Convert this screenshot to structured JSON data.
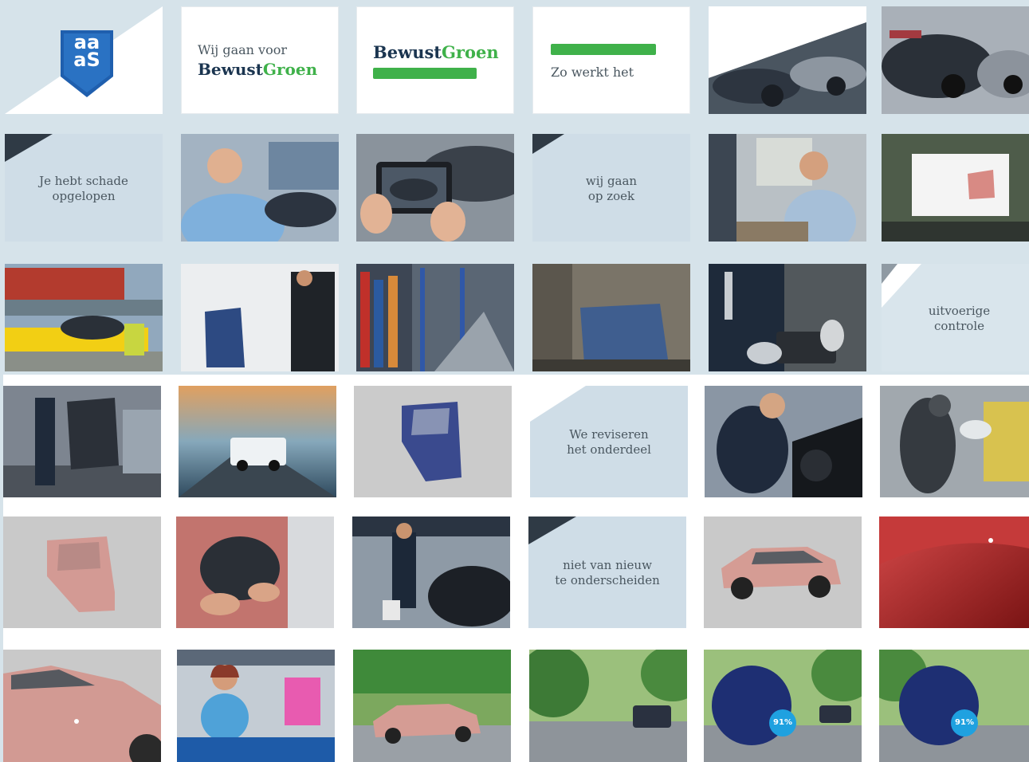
{
  "colors": {
    "band": "#d6e3ea",
    "light_blue_tile": "#cfdde7",
    "grey_tile": "#c9c9c9",
    "brand_navy": "#1b3550",
    "brand_green": "#3fb14a",
    "logo_blue": "#1f5fae"
  },
  "logo": {
    "top": "aa",
    "bottom": "aS"
  },
  "tiles": {
    "slogan": {
      "line1": "Wij gaan voor",
      "bewust": "Bewust",
      "groen": "Groen"
    },
    "brand": {
      "bewust": "Bewust",
      "groen": "Groen"
    },
    "how": {
      "text": "Zo werkt het"
    },
    "schade": {
      "line1": "Je hebt schade",
      "line2": "opgelopen"
    },
    "zoek": {
      "line1": "wij gaan",
      "line2": "op zoek"
    },
    "controle": {
      "line1": "uitvoerige",
      "line2": "controle"
    },
    "reviseren": {
      "line1": "We reviseren",
      "line2": "het onderdeel"
    },
    "nieuw": {
      "line1": "niet van nieuw",
      "line2": "te onderscheiden"
    },
    "badge1": {
      "score": "91%"
    },
    "badge2": {
      "score": "91%"
    }
  }
}
